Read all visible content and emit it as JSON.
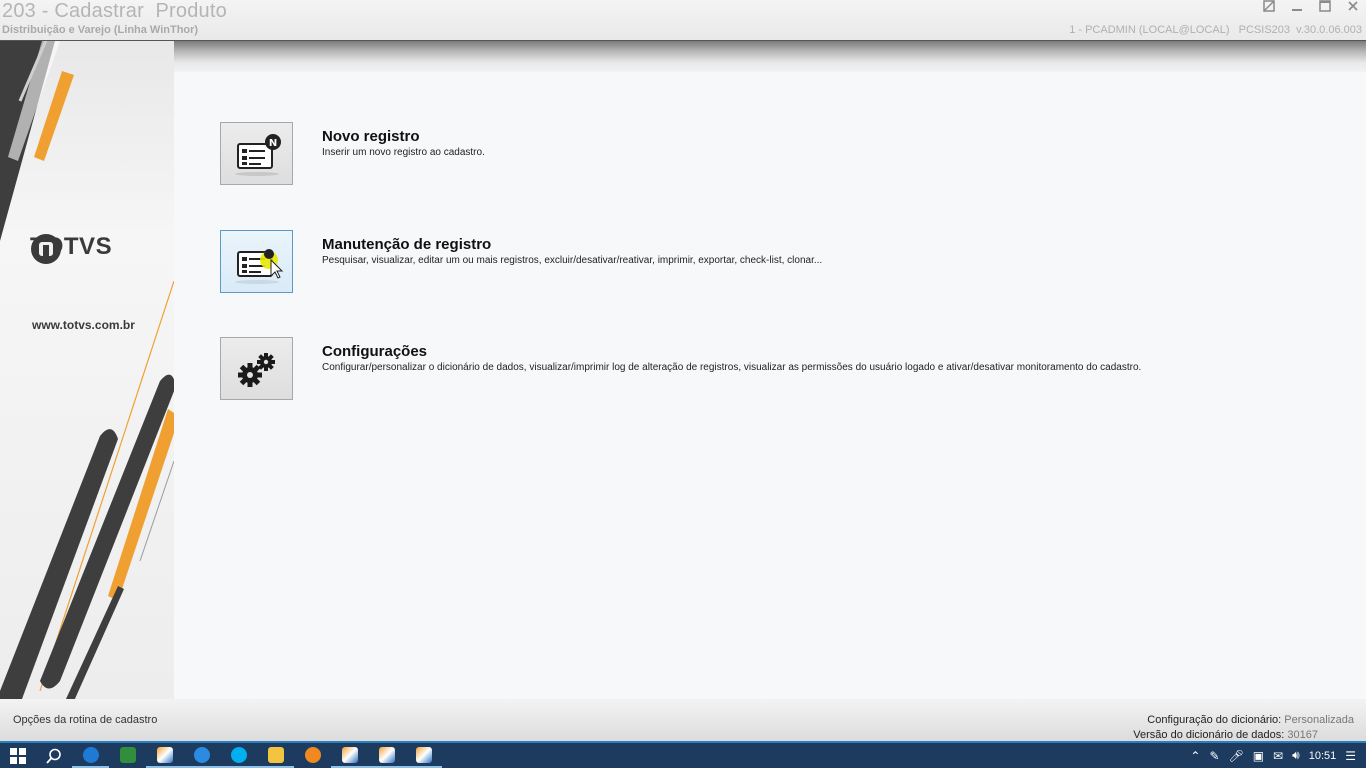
{
  "window": {
    "title": "203 - Cadastrar  Produto",
    "subtitle": "Distribuição e Varejo (Linha WinThor)",
    "info": "1 - PCADMIN (LOCAL@LOCAL)   PCSIS203  v.30.0.06.003"
  },
  "brand": {
    "logo_text": "TOTVS",
    "website": "www.totvs.com.br"
  },
  "options": [
    {
      "title": "Novo registro",
      "description": "Inserir um novo registro ao cadastro."
    },
    {
      "title": "Manutenção de registro",
      "description": "Pesquisar, visualizar, editar um ou mais registros, excluir/desativar/reativar, imprimir, exportar, check-list,  clonar..."
    },
    {
      "title": "Configurações",
      "description": "Configurar/personalizar o dicionário de dados, visualizar/imprimir log de alteração de registros, visualizar as permissões do usuário logado e ativar/desativar monitoramento do cadastro."
    }
  ],
  "status": {
    "left": "Opções da rotina de cadastro",
    "dict_config_label": "Configuração do dicionário:",
    "dict_config_value": "Personalizada",
    "dict_version_label": "Versão do dicionário de dados:",
    "dict_version_value": "30167"
  },
  "taskbar": {
    "clock": "10:51",
    "apps": [
      "teamviewer",
      "winthor-tree",
      "winthor",
      "teamviewer-blue",
      "skype",
      "file-explorer",
      "app-orange",
      "winthor",
      "winthor",
      "winthor"
    ],
    "colors": {
      "bar": "#1d3a5f",
      "accent": "#2a7fc0"
    }
  }
}
